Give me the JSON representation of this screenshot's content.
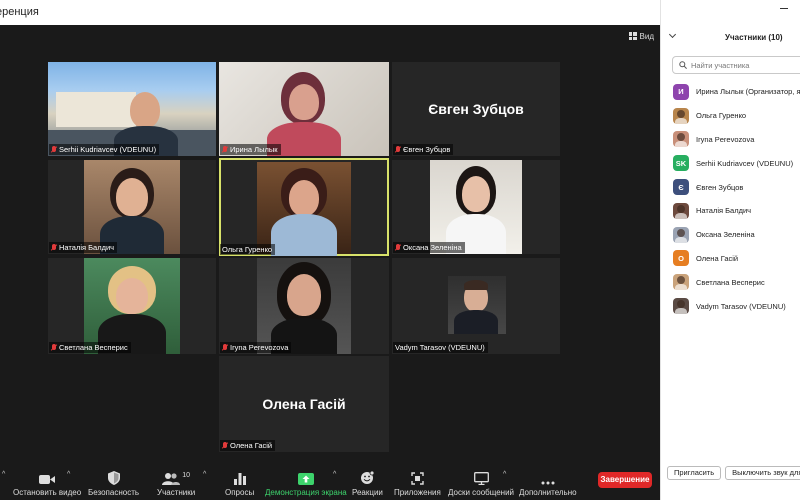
{
  "window": {
    "title": "еренция"
  },
  "view": {
    "label": "Вид"
  },
  "tiles": {
    "t1": {
      "label": "Serhii Kudriavcev (VDEUNU)"
    },
    "t2": {
      "label": "Ирина Лылык"
    },
    "t3": {
      "name": "Євген Зубцов",
      "label": "Євген Зубцов"
    },
    "t4": {
      "label": "Наталія Балдич"
    },
    "t5": {
      "label": "Ольга Гуренко"
    },
    "t6": {
      "label": "Оксана Зеленіна"
    },
    "t7": {
      "label": "Светлана Весперис"
    },
    "t8": {
      "label": "Iryna Perevozova"
    },
    "t9": {
      "label": "Vadym Tarasov (VDEUNU)"
    },
    "t10": {
      "name": "Олена Гасій",
      "label": "Олена Гасій"
    }
  },
  "toolbar": {
    "stop_video": "Остановить видео",
    "security": "Безопасность",
    "participants": "Участники",
    "participants_count": "10",
    "polls": "Опросы",
    "share_screen": "Демонстрация экрана",
    "reactions": "Реакции",
    "apps": "Приложения",
    "whiteboards": "Доски сообщений",
    "more": "Дополнительно",
    "end": "Завершение"
  },
  "panel": {
    "title": "Участники (10)",
    "search_placeholder": "Найти участника",
    "participants": [
      {
        "name": "Ирина Лылык (Организатор, я)",
        "initial": "И",
        "color": "#8e44ad",
        "icon": "initial"
      },
      {
        "name": "Ольга Гуренко",
        "initial": "",
        "color": "#b8854c",
        "icon": "photo"
      },
      {
        "name": "Iryna Perevozova",
        "initial": "",
        "color": "#c88f79",
        "icon": "photo"
      },
      {
        "name": "Serhii Kudriavcev (VDEUNU)",
        "initial": "SK",
        "color": "#27ae60",
        "icon": "initial"
      },
      {
        "name": "Євген Зубцов",
        "initial": "Є",
        "color": "#3d4f7c",
        "icon": "initial"
      },
      {
        "name": "Наталія Балдич",
        "initial": "",
        "color": "#6d4a3e",
        "icon": "photo"
      },
      {
        "name": "Оксана Зеленіна",
        "initial": "",
        "color": "#9aa3b3",
        "icon": "photo"
      },
      {
        "name": "Олена Гасій",
        "initial": "О",
        "color": "#e67e22",
        "icon": "initial"
      },
      {
        "name": "Светлана Весперис",
        "initial": "",
        "color": "#c9a27a",
        "icon": "photo"
      },
      {
        "name": "Vadym Tarasov (VDEUNU)",
        "initial": "",
        "color": "#5a4a44",
        "icon": "photo"
      }
    ],
    "invite": "Пригласить",
    "mute_all": "Выключить звук для"
  },
  "colors": {
    "accent_green": "#3dd36c",
    "end_red": "#e02828",
    "active_speaker": "#d8e26a"
  }
}
